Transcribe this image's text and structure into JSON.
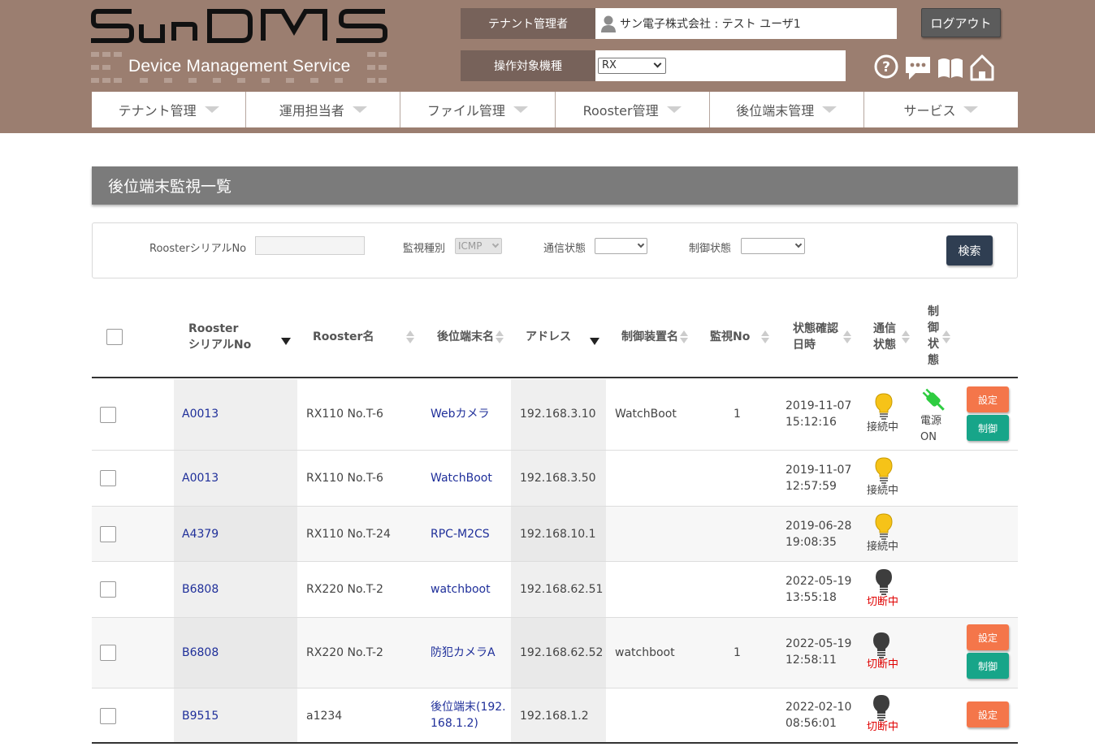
{
  "header": {
    "logo_text": "SunDMS",
    "logo_sub": "Device Management Service",
    "tenant_label": "テナント管理者",
    "tenant_value": "サン電子株式会社 : テスト ユーザ1",
    "device_label": "操作対象機種",
    "device_selected": "RX",
    "logout_label": "ログアウト",
    "icons": [
      "help-icon",
      "chat-icon",
      "manual-icon",
      "home-icon"
    ]
  },
  "nav": {
    "items": [
      {
        "label": "テナント管理"
      },
      {
        "label": "運用担当者"
      },
      {
        "label": "ファイル管理"
      },
      {
        "label": "Rooster管理"
      },
      {
        "label": "後位端末管理"
      },
      {
        "label": "サービス"
      }
    ]
  },
  "page": {
    "title": "後位端末監視一覧"
  },
  "search": {
    "serial_label": "RoosterシリアルNo",
    "serial_value": "",
    "monitor_type_label": "監視種別",
    "monitor_type_value": "ICMP",
    "comm_status_label": "通信状態",
    "comm_status_value": "",
    "control_status_label": "制御状態",
    "control_status_value": "",
    "search_button": "検索"
  },
  "table": {
    "headers": {
      "serial_line1": "Rooster",
      "serial_line2": "シリアルNo",
      "rooster_name": "Rooster名",
      "device_name": "後位端末名",
      "address": "アドレス",
      "controller_name": "制御装置名",
      "monitor_no": "監視No",
      "checked_line1": "状態確認",
      "checked_line2": "日時",
      "comm_line1": "通信",
      "comm_line2": "状態",
      "ctrl_line1": "制",
      "ctrl_line2": "御",
      "ctrl_line3": "状",
      "ctrl_line4": "態"
    },
    "rows": [
      {
        "serial": "A0013",
        "rooster": "RX110 No.T-6",
        "device_line1": "Webカメラ",
        "device_line2": "",
        "address": "192.168.3.10",
        "controller": "WatchBoot",
        "monitor_no": "1",
        "date": "2019-11-07",
        "time": "15:12:16",
        "comm": "接続中",
        "ctrl_line1": "電源",
        "ctrl_line2": "ON",
        "btn_set": "設定",
        "btn_ctl": "制御"
      },
      {
        "serial": "A0013",
        "rooster": "RX110 No.T-6",
        "device_line1": "WatchBoot",
        "device_line2": "",
        "address": "192.168.3.50",
        "controller": "",
        "monitor_no": "",
        "date": "2019-11-07",
        "time": "12:57:59",
        "comm": "接続中"
      },
      {
        "serial": "A4379",
        "rooster": "RX110 No.T-24",
        "device_line1": "RPC-M2CS",
        "device_line2": "",
        "address": "192.168.10.1",
        "controller": "",
        "monitor_no": "",
        "date": "2019-06-28",
        "time": "19:08:35",
        "comm": "接続中"
      },
      {
        "serial": "B6808",
        "rooster": "RX220 No.T-2",
        "device_line1": "watchboot",
        "device_line2": "",
        "address": "192.168.62.51",
        "controller": "",
        "monitor_no": "",
        "date": "2022-05-19",
        "time": "13:55:18",
        "comm": "切断中"
      },
      {
        "serial": "B6808",
        "rooster": "RX220 No.T-2",
        "device_line1": "防犯カメラA",
        "device_line2": "",
        "address": "192.168.62.52",
        "controller": "watchboot",
        "monitor_no": "1",
        "date": "2022-05-19",
        "time": "12:58:11",
        "comm": "切断中",
        "btn_set": "設定",
        "btn_ctl": "制御"
      },
      {
        "serial": "B9515",
        "rooster": "a1234",
        "device_line1": "後位端末(192.",
        "device_line2": "168.1.2)",
        "address": "192.168.1.2",
        "controller": "",
        "monitor_no": "",
        "date": "2022-02-10",
        "time": "08:56:01",
        "comm": "切断中",
        "btn_set": "設定"
      }
    ]
  },
  "colors": {
    "header_bg": "#9b7e70",
    "header_label_bg": "#77625a",
    "title_bar": "#7b7b7b",
    "search_btn": "#2f3e52",
    "btn_set": "#f4764a",
    "btn_ctl": "#17a589",
    "connected": "#444444",
    "disconnected": "#e00000",
    "link": "#1f2f9a"
  }
}
